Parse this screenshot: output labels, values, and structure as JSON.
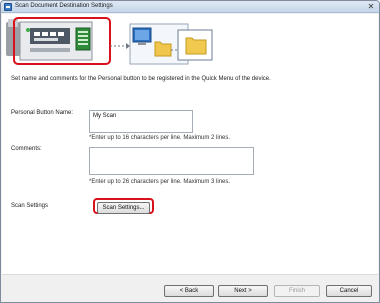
{
  "window": {
    "title": "Scan Document Destination Settings",
    "close_glyph": "✕"
  },
  "banner": {
    "icons": [
      "device-panel-icon",
      "computer-icon",
      "folder-icon"
    ]
  },
  "instruction": "Set name and comments for the Personal button to be registered in the Quick Menu of the device.",
  "form": {
    "personal_button_label": "Personal Button Name:",
    "personal_button_value": "My Scan",
    "personal_button_hint": "*Enter up to 16 characters per line. Maximum 2 lines.",
    "comments_label": "Comments:",
    "comments_value": "",
    "comments_hint": "*Enter up to 26 characters per line. Maximum 3 lines.",
    "scan_settings_label": "Scan Settings",
    "scan_settings_button": "Scan Settings..."
  },
  "footer": {
    "back": "< Back",
    "next": "Next >",
    "finish": "Finish",
    "cancel": "Cancel"
  },
  "colors": {
    "highlight": "#d8111b",
    "title_gradient_top": "#dfe9f5",
    "title_gradient_bottom": "#c5d6ea"
  }
}
